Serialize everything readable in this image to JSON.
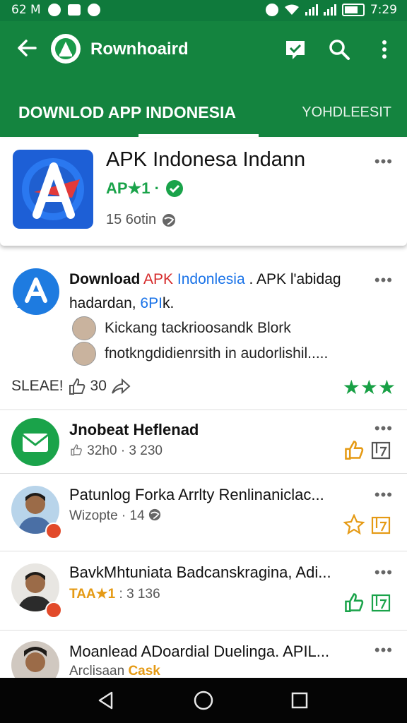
{
  "status": {
    "left_text": "62 M",
    "time": "7:29"
  },
  "appbar": {
    "title": "Rownhoaird"
  },
  "tabs": [
    {
      "label": "DOWNLOD APP INDONESIA"
    },
    {
      "label": "YOHDLEESIT"
    }
  ],
  "featured": {
    "title": "APK Indonesa Indann",
    "sub": "AP★1 ·",
    "meta": "15 6otin",
    "more": "•••"
  },
  "post": {
    "line1_a": "Download",
    "line1_b": "APK",
    "line1_c": "Indonlesia",
    "line1_d": ". APK l'abidag",
    "line2": "hadardan, ",
    "line2_link": "6PI",
    "line2_end": "k.",
    "comment1": "Kickang  tackrioosandk Blork",
    "comment2": "fnotkngdidienrsith in audorlishil.....",
    "share_label": "SLEAE!",
    "share_count": "30",
    "stars": "★★★",
    "more": "•••"
  },
  "rows": [
    {
      "title": "Jnobeat Heflenad",
      "sub": "32h0 · 3 230",
      "more": "•••"
    },
    {
      "title": "Patunlog Forka Arrlty Renlinaniclac...",
      "sub": "Wizopte · 14",
      "more": "•••"
    },
    {
      "title": "BavkMhtuniata Badcanskragina, Adi...",
      "sub_hl": "TAA★1",
      "sub": ": 3 136",
      "more": "•••"
    },
    {
      "title": "Moanlead ADoardial Duelinga. APIL...",
      "sub": "Arclisaan",
      "sub_hl": "Cask",
      "more": "•••"
    }
  ],
  "colors": {
    "primary": "#14843f",
    "status_bar": "#0f7a3c",
    "accent_green": "#1aa34a",
    "accent_orange": "#e59a14",
    "link_blue": "#1a73e8",
    "link_red": "#d62d2d"
  }
}
